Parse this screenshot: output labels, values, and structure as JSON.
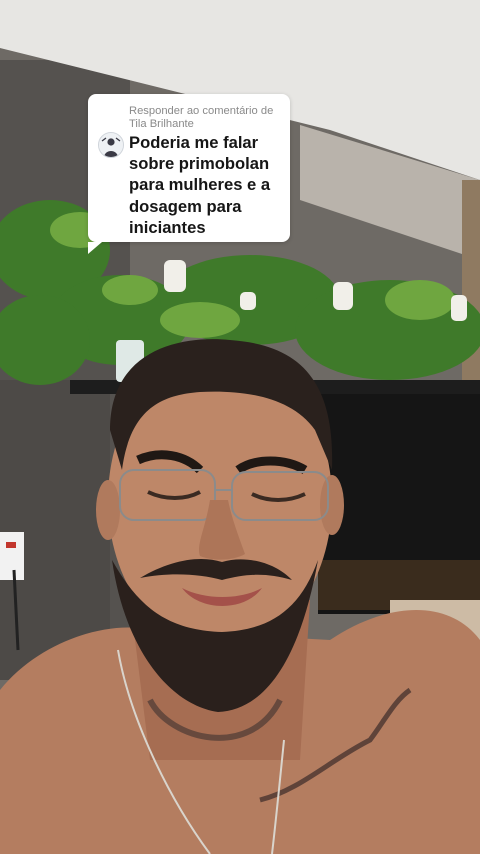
{
  "reply_sticker": {
    "header": "Responder ao comentário de Tila Brilhante",
    "avatar_icon": "user-avatar-icon",
    "comment": "Poderia me falar\nsobre primobolan\npara mulheres e a\ndosagem para\niniciantes"
  },
  "colors": {
    "sticker_bg": "#ffffff",
    "header_text": "#8a8a8a",
    "comment_text": "#161616"
  }
}
